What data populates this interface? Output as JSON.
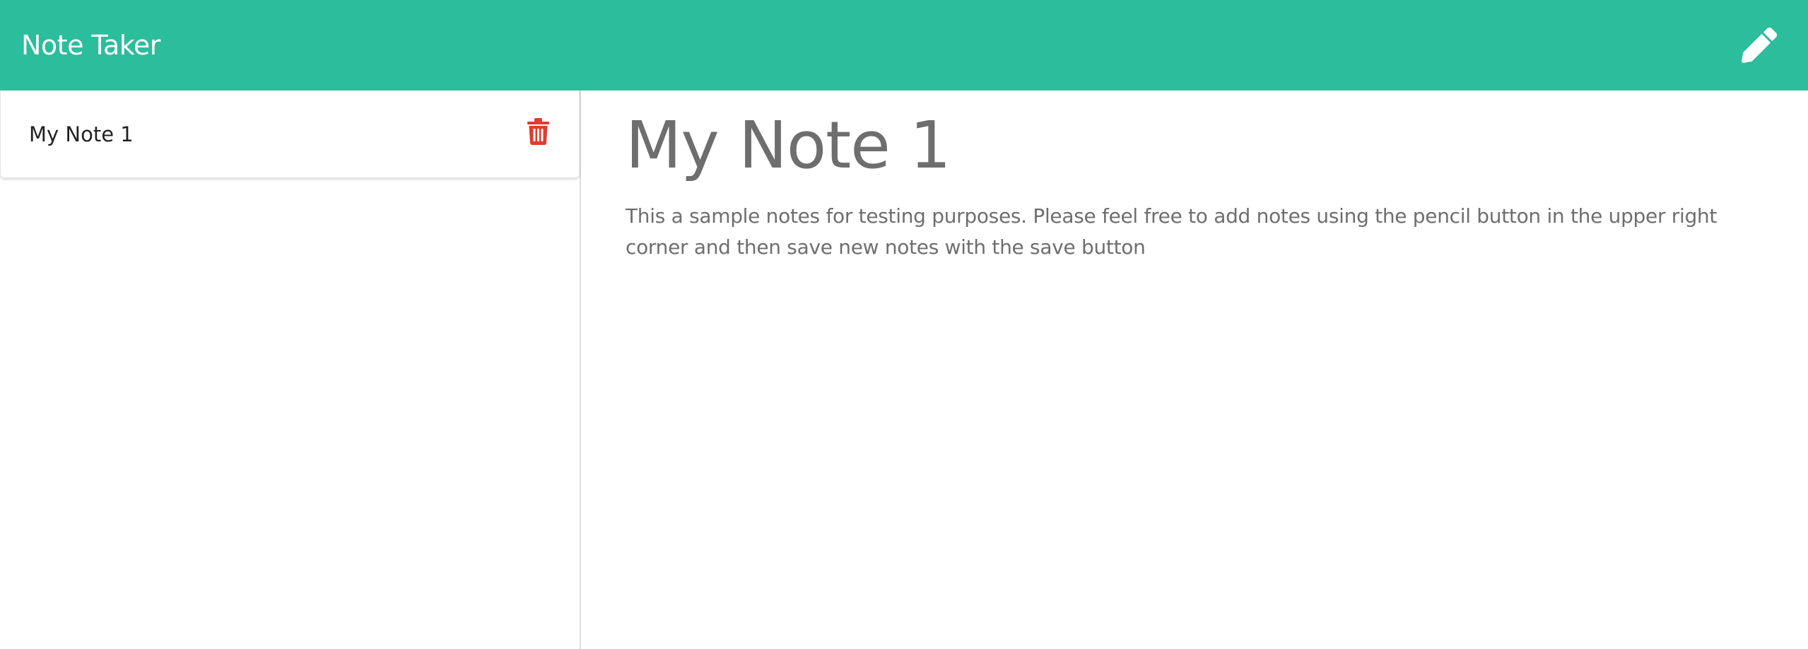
{
  "navbar": {
    "brand": "Note Taker",
    "new_note_icon": "pencil-icon",
    "background": "#2bbd9c"
  },
  "sidebar": {
    "notes": [
      {
        "title": "My Note 1",
        "delete_icon": "trash-icon"
      }
    ]
  },
  "editor": {
    "title": "My Note 1",
    "text": "This a sample notes for testing purposes. Please feel free to add notes using the pencil button in the upper right corner and then save new notes with the save button"
  },
  "colors": {
    "accent": "#2bbd9c",
    "delete": "#e03c2f",
    "note_text": "#6e6e6e"
  }
}
